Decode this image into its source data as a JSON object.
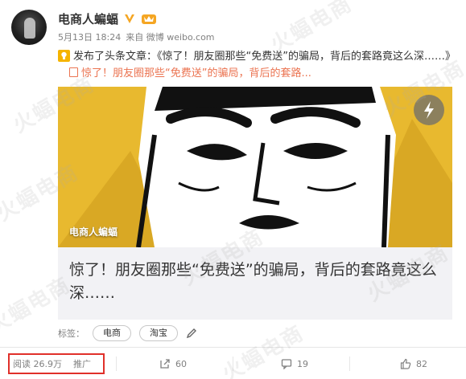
{
  "author": {
    "name": "电商人蝙蝠",
    "verified_icon": "verified-v-icon",
    "vip_icon": "vip-crown-icon"
  },
  "meta": {
    "date": "5月13日 18:24",
    "source": "来自 微博 weibo.com"
  },
  "headline": {
    "prefix": "发布了头条文章：",
    "text": "《惊了！朋友圈那些“免费送”的骗局，背后的套路竟这么深……》",
    "link_text": "惊了！朋友圈那些“免费送”的骗局，背后的套路..."
  },
  "card": {
    "image_caption": "电商人蝙蝠",
    "title": "惊了！朋友圈那些“免费送”的骗局，背后的套路竟这么深……"
  },
  "tags": {
    "label": "标签：",
    "items": [
      "电商",
      "淘宝"
    ]
  },
  "actions": {
    "reads_label": "阅读 26.9万",
    "promote_label": "推广",
    "repost_count": "60",
    "comment_count": "19",
    "like_count": "82"
  },
  "watermark": "火蝠电商",
  "colors": {
    "accent": "#eb7350",
    "highlight_box": "#e0302a",
    "image_bg": "#e8b92f"
  }
}
